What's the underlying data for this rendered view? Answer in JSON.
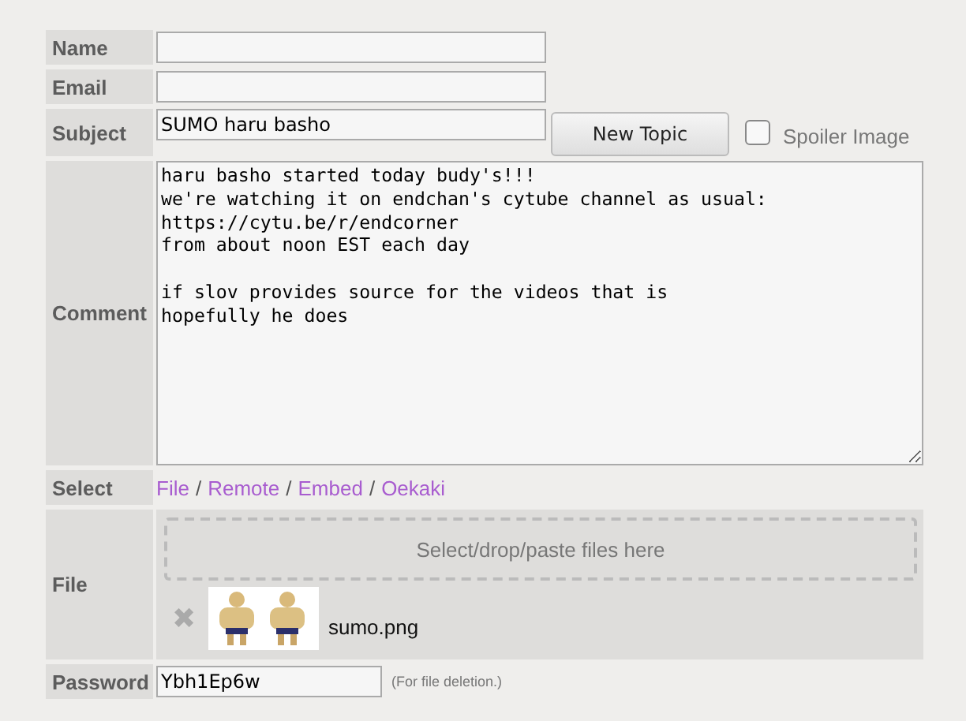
{
  "form": {
    "name": {
      "label": "Name"
    },
    "email": {
      "label": "Email"
    },
    "subject": {
      "label": "Subject",
      "value": "SUMO haru basho",
      "button": "New Topic",
      "spoiler": {
        "label": "Spoiler Image",
        "checked": false
      }
    },
    "comment": {
      "label": "Comment",
      "value": "haru basho started today budy's!!!\nwe're watching it on endchan's cytube channel as usual:\nhttps://cytu.be/r/endcorner\nfrom about noon EST each day\n\nif slov provides source for the videos that is\nhopefully he does"
    },
    "select": {
      "label": "Select",
      "links": [
        "File",
        "Remote",
        "Embed",
        "Oekaki"
      ],
      "separator": "/"
    },
    "file": {
      "label": "File",
      "dropzone": "Select/drop/paste files here",
      "files": [
        {
          "name": "sumo.png",
          "remove": "✖"
        }
      ]
    },
    "password": {
      "label": "Password",
      "value": "Ybh1Ep6w",
      "note": "(For file deletion.)"
    }
  }
}
